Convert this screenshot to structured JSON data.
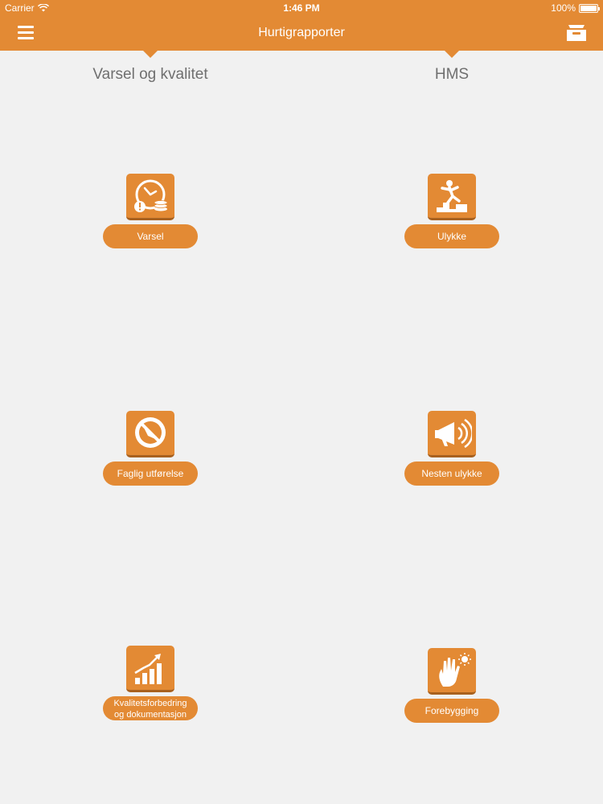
{
  "status_bar": {
    "carrier": "Carrier",
    "time": "1:46 PM",
    "battery": "100%"
  },
  "nav": {
    "title": "Hurtigrapporter",
    "menu_icon": "hamburger-menu-icon",
    "right_icon": "tray-icon"
  },
  "sections": {
    "left": "Varsel og kvalitet",
    "right": "HMS"
  },
  "tiles": {
    "varsel": {
      "label": "Varsel",
      "icon": "clock-warning-icon"
    },
    "ulykke": {
      "label": "Ulykke",
      "icon": "falling-person-icon"
    },
    "faglig": {
      "label": "Faglig utførelse",
      "icon": "prohibited-tool-icon"
    },
    "nesten": {
      "label": "Nesten ulykke",
      "icon": "megaphone-icon"
    },
    "kvalitet": {
      "label_line1": "Kvalitetsforbedring",
      "label_line2": "og dokumentasjon",
      "icon": "growth-chart-icon"
    },
    "forebygging": {
      "label": "Forebygging",
      "icon": "hand-idea-icon"
    }
  },
  "colors": {
    "accent": "#e38a34",
    "accent_dark": "#a8611f",
    "background": "#f1f1f1",
    "section_text": "#6f6f6f"
  }
}
